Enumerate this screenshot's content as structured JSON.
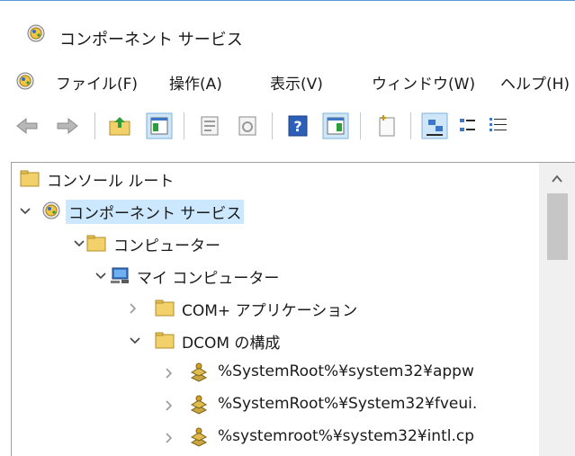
{
  "window": {
    "title": "コンポーネント サービス"
  },
  "menu": {
    "items": [
      {
        "label": "ファイル(F)"
      },
      {
        "label": "操作(A)"
      },
      {
        "label": "表示(V)"
      },
      {
        "label": "ウィンドウ(W)"
      },
      {
        "label": "ヘルプ(H)"
      }
    ]
  },
  "toolbar": {
    "buttons": [
      {
        "icon": "back-arrow-icon"
      },
      {
        "icon": "forward-arrow-icon"
      },
      {
        "icon": "up-folder-icon"
      },
      {
        "icon": "show-hide-console-tree-icon"
      },
      {
        "icon": "properties-icon"
      },
      {
        "icon": "refresh-icon"
      },
      {
        "icon": "help-icon"
      },
      {
        "icon": "show-hide-action-pane-icon"
      },
      {
        "icon": "new-window-icon"
      },
      {
        "icon": "large-icons-view-icon"
      },
      {
        "icon": "small-icons-view-icon"
      },
      {
        "icon": "list-view-icon"
      }
    ]
  },
  "tree": {
    "nodes": [
      {
        "label": "コンソール ルート",
        "icon": "folder-icon",
        "expanded": null
      },
      {
        "label": "コンポーネント サービス",
        "icon": "component-services-icon",
        "expanded": true,
        "selected": true
      },
      {
        "label": "コンピューター",
        "icon": "folder-icon",
        "expanded": true
      },
      {
        "label": "マイ コンピューター",
        "icon": "computer-icon",
        "expanded": true
      },
      {
        "label": "COM+ アプリケーション",
        "icon": "folder-icon",
        "expanded": false
      },
      {
        "label": "DCOM の構成",
        "icon": "folder-icon",
        "expanded": true
      },
      {
        "label": "%SystemRoot%¥system32¥appw",
        "icon": "dcom-app-icon",
        "expanded": false
      },
      {
        "label": "%SystemRoot%¥System32¥fveui.",
        "icon": "dcom-app-icon",
        "expanded": false
      },
      {
        "label": "%systemroot%¥system32¥intl.cp",
        "icon": "dcom-app-icon",
        "expanded": false
      }
    ]
  },
  "colors": {
    "selection": "#cce8ff",
    "folder": "#f2d16b",
    "window_border": "#5b9bd5"
  }
}
